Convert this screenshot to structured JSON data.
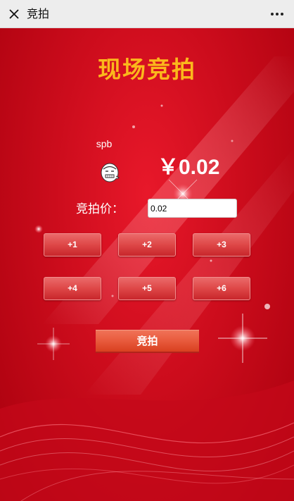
{
  "navbar": {
    "title": "竞拍",
    "close_icon": "close-icon",
    "more_icon": "more-icon"
  },
  "auction": {
    "title": "现场竞拍",
    "user_name": "spb",
    "avatar_icon": "meme-face-avatar",
    "current_price": "￥0.02",
    "bid_label": "竞拍价：",
    "bid_value": "0.02",
    "increments": [
      "+1",
      "+2",
      "+3",
      "+4",
      "+5",
      "+6"
    ],
    "submit_label": "竞拍"
  },
  "colors": {
    "title": "#fbb81c",
    "background": "#cc0c1c",
    "button": "#de4747",
    "submit": "#e85a3c"
  }
}
